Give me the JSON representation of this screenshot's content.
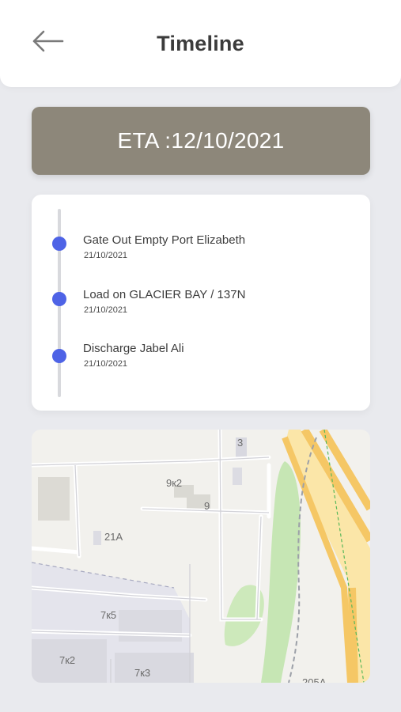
{
  "header": {
    "title": "Timeline",
    "back_icon": "arrow-left-icon"
  },
  "eta": {
    "text": "ETA :12/10/2021"
  },
  "timeline": {
    "accent_color": "#4e63e6",
    "events": [
      {
        "title": "Gate Out Empty Port Elizabeth",
        "date": "21/10/2021"
      },
      {
        "title": "Load on GLACIER BAY / 137N",
        "date": "21/10/2021"
      },
      {
        "title": "Discharge Jabel Ali",
        "date": "21/10/2021"
      }
    ]
  },
  "map": {
    "labels": [
      "3",
      "9к2",
      "9",
      "21A",
      "7к5",
      "7к2",
      "7к3",
      "205A"
    ]
  },
  "colors": {
    "background": "#e9eaee",
    "eta_banner": "#8d877a",
    "card": "#ffffff"
  }
}
